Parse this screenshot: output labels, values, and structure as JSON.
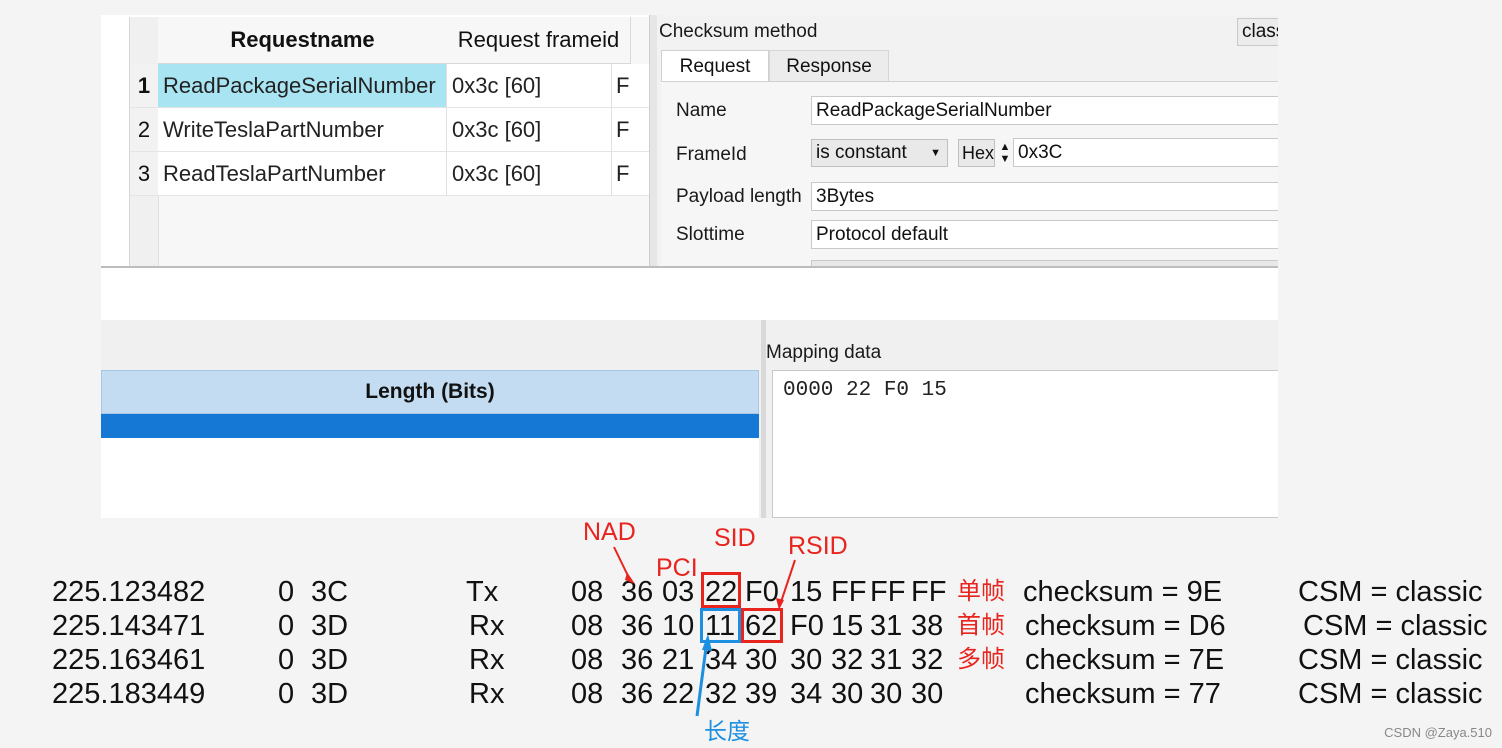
{
  "request_table": {
    "headers": [
      "Requestname",
      "Request frameid"
    ],
    "rows": [
      {
        "num": "1",
        "name": "ReadPackageSerialNumber",
        "frameid": "0x3c [60]",
        "cut": "F"
      },
      {
        "num": "2",
        "name": "WriteTeslaPartNumber",
        "frameid": "0x3c [60]",
        "cut": "F"
      },
      {
        "num": "3",
        "name": "ReadTeslaPartNumber",
        "frameid": "0x3c [60]",
        "cut": "F"
      }
    ]
  },
  "props": {
    "checksum_label": "Checksum method",
    "checksum_value": "class",
    "tabs": [
      "Request",
      "Response"
    ],
    "name_label": "Name",
    "name_value": "ReadPackageSerialNumber",
    "frameid_label": "FrameId",
    "frameid_mode": "is constant",
    "hex_label": "Hex",
    "frameid_value": "0x3C",
    "payload_label": "Payload length",
    "payload_value": "3Bytes",
    "slottime_label": "Slottime",
    "slottime_value": "Protocol default"
  },
  "signals": {
    "length_header": "Length (Bits)"
  },
  "mapping": {
    "title": "Mapping data",
    "content": "0000 22 F0 15"
  },
  "log": [
    {
      "time": "225.123482",
      "ch": "0",
      "id": "3C",
      "dir": "Tx",
      "bytes": [
        "08",
        "36",
        "03",
        "22",
        "F0",
        "15",
        "FF",
        "FF",
        "FF"
      ],
      "frame": "单帧",
      "checksum": "checksum = 9E",
      "csm": "CSM = classic"
    },
    {
      "time": "225.143471",
      "ch": "0",
      "id": "3D",
      "dir": "Rx",
      "bytes": [
        "08",
        "36",
        "10",
        "11",
        "62",
        "F0",
        "15",
        "31",
        "38"
      ],
      "frame": "首帧",
      "checksum": "checksum = D6",
      "csm": "CSM = classic"
    },
    {
      "time": "225.163461",
      "ch": "0",
      "id": "3D",
      "dir": "Rx",
      "bytes": [
        "08",
        "36",
        "21",
        "34",
        "30",
        "30",
        "32",
        "31",
        "32"
      ],
      "frame": "多帧",
      "checksum": "checksum = 7E",
      "csm": "CSM = classic"
    },
    {
      "time": "225.183449",
      "ch": "0",
      "id": "3D",
      "dir": "Rx",
      "bytes": [
        "08",
        "36",
        "22",
        "32",
        "39",
        "34",
        "30",
        "30",
        "30"
      ],
      "frame": "",
      "checksum": "checksum = 77",
      "csm": "CSM = classic"
    }
  ],
  "annotations": {
    "nad": "NAD",
    "pci": "PCI",
    "sid": "SID",
    "rsid": "RSID",
    "length": "长度",
    "red_color": "#e8241e",
    "blue_color": "#1c8fe0"
  },
  "watermark": "CSDN @Zaya.510"
}
